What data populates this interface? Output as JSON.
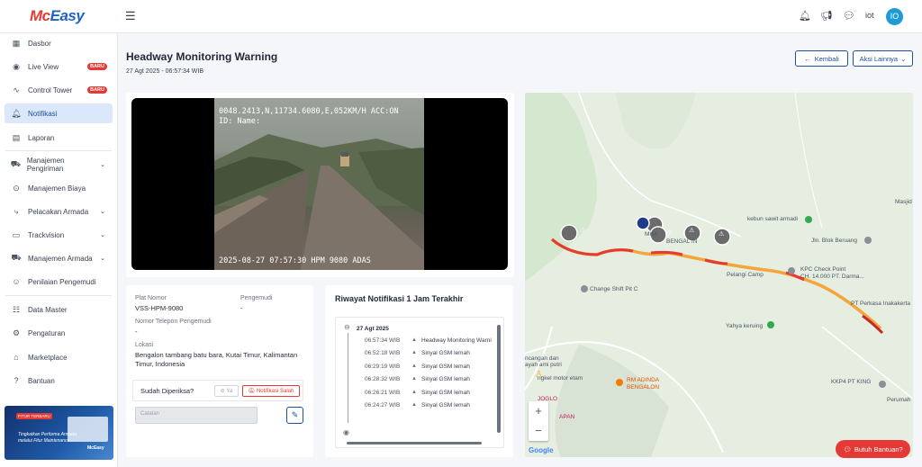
{
  "brand": {
    "part1": "Mc",
    "part2": "Easy"
  },
  "header": {
    "user_name": "iot",
    "avatar_initials": "IO"
  },
  "sidebar": {
    "items": [
      {
        "label": "Dasbor",
        "icon": "grid-icon"
      },
      {
        "label": "Live View",
        "icon": "broadcast-icon",
        "badge": "BARU"
      },
      {
        "label": "Control Tower",
        "icon": "pulse-icon",
        "badge": "BARU"
      },
      {
        "label": "Notifikasi",
        "icon": "bell-icon"
      },
      {
        "label": "Laporan",
        "icon": "book-icon"
      },
      {
        "label": "Manajemen Pengiriman",
        "icon": "truck-icon"
      },
      {
        "label": "Manajemen Biaya",
        "icon": "coin-icon"
      },
      {
        "label": "Pelacakan Armada",
        "icon": "route-icon"
      },
      {
        "label": "Trackvision",
        "icon": "camera-icon"
      },
      {
        "label": "Manajemen Armada",
        "icon": "truck-icon"
      },
      {
        "label": "Penilaian Pengemudi",
        "icon": "person-icon"
      },
      {
        "label": "Data Master",
        "icon": "database-icon"
      },
      {
        "label": "Pengaturan",
        "icon": "gear-icon"
      },
      {
        "label": "Marketplace",
        "icon": "store-icon"
      },
      {
        "label": "Bantuan",
        "icon": "help-icon"
      }
    ],
    "promo": {
      "tag": "FITUR TERBARU",
      "text": "Tingkatkan Performa Armada melalui Fitur Maintenance",
      "logo": "McEasy"
    }
  },
  "page": {
    "title": "Headway Monitoring Warning",
    "subtitle": "27 Agt 2025 - 06:57:34 WIB",
    "back_label": "Kembali",
    "more_label": "Aksi Lainnya"
  },
  "video": {
    "osd_top": "0048.2413,N,11734.6080,E,052KM/H ACC:ON",
    "osd_id": "ID: Name:",
    "osd_bottom": "2025-08-27 07:57:30    HPM 9080 ADAS"
  },
  "details": {
    "plate_label": "Plat Nomor",
    "plate_value": "VSS-HPM-9080",
    "driver_label": "Pengemudi",
    "driver_value": "-",
    "phone_label": "Nomor Telepon Pengemudi",
    "phone_value": "-",
    "location_label": "Lokasi",
    "location_value": "Bengalon tambang batu bara, Kutai Timur, Kalimantan Timur, Indonesia",
    "checked_question": "Sudah Diperiksa?",
    "yes_label": "Ya",
    "wrong_label": "Notifikasi Salah",
    "note_placeholder": "Catatan"
  },
  "history": {
    "title": "Riwayat Notifikasi 1 Jam Terakhir",
    "date": "27 Agt 2025",
    "rows": [
      {
        "time": "06:57:34",
        "tz": "WIB",
        "msg": "Headway Monitoring Warni"
      },
      {
        "time": "06:52:18",
        "tz": "WIB",
        "msg": "Sinyal GSM lemah"
      },
      {
        "time": "06:29:19",
        "tz": "WIB",
        "msg": "Sinyal GSM lemah"
      },
      {
        "time": "06:28:32",
        "tz": "WIB",
        "msg": "Sinyal GSM lemah"
      },
      {
        "time": "06:26:21",
        "tz": "WIB",
        "msg": "Sinyal GSM lemah"
      },
      {
        "time": "06:24:27",
        "tz": "WIB",
        "msg": "Sinyal GSM lemah"
      }
    ]
  },
  "map": {
    "labels": [
      {
        "text": "kebun sawit armadi"
      },
      {
        "text": "Jln. Blok Beruang"
      },
      {
        "text": "KPC Check Point"
      },
      {
        "text": "CH. 14.000 PT. Darma..."
      },
      {
        "text": "Pelangi Camp"
      },
      {
        "text": "Change Shift Pit C"
      },
      {
        "text": "PT Perkasa Inakakerta"
      },
      {
        "text": "Yahya keruing"
      },
      {
        "text": "RM ADINDA"
      },
      {
        "text": "BENGALON"
      },
      {
        "text": "KKP4 PT KING"
      },
      {
        "text": "Perumah"
      },
      {
        "text": "MHA"
      },
      {
        "text": "BENGAL  IN"
      },
      {
        "text": "Masjid"
      },
      {
        "text": "ncangan dan"
      },
      {
        "text": "ayah ami putri"
      },
      {
        "text": "ngkel motor etam"
      },
      {
        "text": "JOGLO"
      },
      {
        "text": "APAN"
      }
    ],
    "google": "Google",
    "zoom_in": "+",
    "zoom_out": "−"
  },
  "help_label": "Butuh Bantuan?"
}
